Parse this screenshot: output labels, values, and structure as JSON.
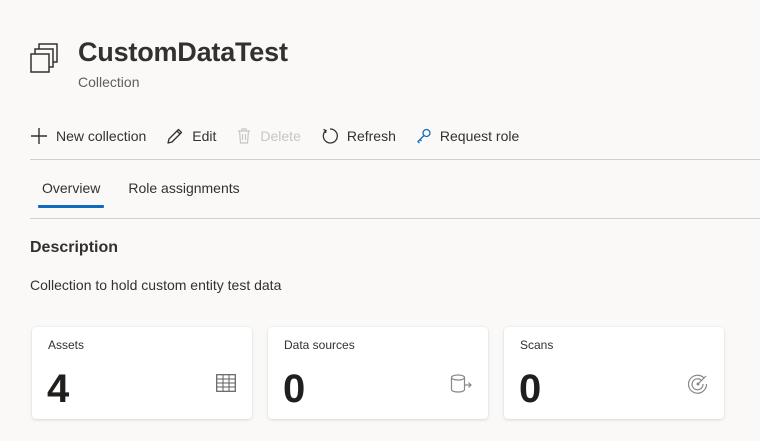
{
  "header": {
    "icon": "collection-icon",
    "title": "CustomDataTest",
    "subtitle": "Collection"
  },
  "toolbar": {
    "new_collection": "New collection",
    "edit": "Edit",
    "delete": "Delete",
    "refresh": "Refresh",
    "request_role": "Request role"
  },
  "tabs": [
    {
      "label": "Overview",
      "active": true
    },
    {
      "label": "Role assignments",
      "active": false
    }
  ],
  "description": {
    "heading": "Description",
    "text": "Collection to hold custom entity test data"
  },
  "cards": [
    {
      "label": "Assets",
      "value": "4",
      "icon": "table-icon"
    },
    {
      "label": "Data sources",
      "value": "0",
      "icon": "data-source-icon"
    },
    {
      "label": "Scans",
      "value": "0",
      "icon": "scan-icon"
    }
  ],
  "colors": {
    "accent": "#0f6cbd",
    "background": "#faf9f8",
    "card": "#ffffff"
  }
}
